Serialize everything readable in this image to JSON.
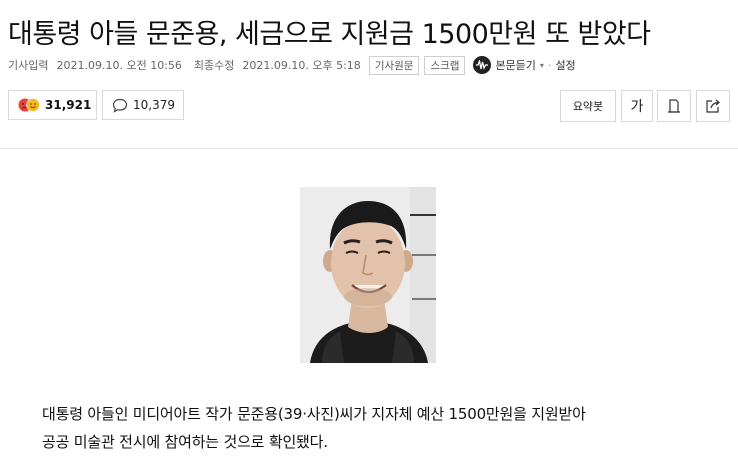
{
  "headline": "대통령 아들 문준용, 세금으로 지원금 1500만원 또 받았다",
  "meta": {
    "published_label": "기사입력",
    "published_time": "2021.09.10. 오전 10:56",
    "modified_label": "최종수정",
    "modified_time": "2021.09.10. 오후 5:18",
    "original_tag": "기사원문",
    "scrap_tag": "스크랩",
    "listen_label": "본문듣기",
    "settings_label": "설정"
  },
  "reactions": {
    "reaction_count": "31,921",
    "comment_count": "10,379"
  },
  "tools": {
    "summary_label": "요약봇",
    "font_label": "가"
  },
  "body": {
    "line1": "대통령 아들인 미디어아트 작가 문준용(39·사진)씨가 지자체 예산 1500만원을 지원받아",
    "line2": "공공 미술관 전시에 참여하는 것으로 확인됐다."
  },
  "icons": {
    "reaction": "angry-face-icon",
    "comment": "speech-bubble-icon",
    "print": "print-icon",
    "share": "share-icon",
    "listen": "sound-wave-icon"
  },
  "colors": {
    "angry": "#e8413c",
    "smile": "#f5b921"
  }
}
